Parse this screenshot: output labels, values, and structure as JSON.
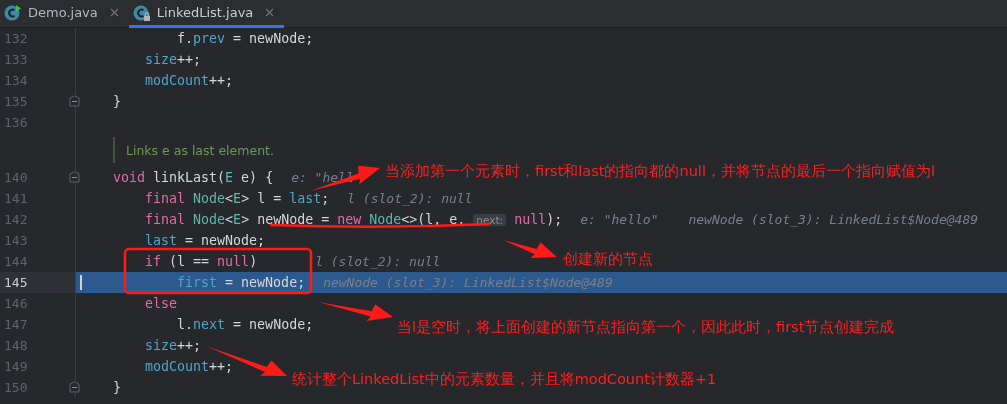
{
  "tabs": [
    {
      "label": "Demo.java",
      "selected": false,
      "runnable": true,
      "read_only": false
    },
    {
      "label": "LinkedList.java",
      "selected": true,
      "runnable": false,
      "read_only": true
    }
  ],
  "lines": [
    {
      "number": "132",
      "fold": false,
      "current": false,
      "tokens": [
        {
          "text": "        f.",
          "kind": "plain"
        },
        {
          "text": "prev",
          "kind": "field"
        },
        {
          "text": " = newNode;",
          "kind": "plain"
        }
      ]
    },
    {
      "number": "133",
      "fold": false,
      "current": false,
      "tokens": [
        {
          "text": "    size",
          "kind": "field"
        },
        {
          "text": "++;",
          "kind": "plain"
        }
      ]
    },
    {
      "number": "134",
      "fold": false,
      "current": false,
      "tokens": [
        {
          "text": "    modCount",
          "kind": "field"
        },
        {
          "text": "++;",
          "kind": "plain"
        }
      ]
    },
    {
      "number": "135",
      "fold": true,
      "current": false,
      "tokens": [
        {
          "text": "}",
          "kind": "plain"
        }
      ]
    },
    {
      "number": "136",
      "fold": false,
      "current": false
    },
    {
      "kind": "doc",
      "text": "Links e as last element."
    },
    {
      "number": "140",
      "fold": true,
      "current": false,
      "tokens": [
        {
          "text": "void",
          "kind": "keyword"
        },
        {
          "text": " linkLast(",
          "kind": "plain"
        },
        {
          "text": "E",
          "kind": "type"
        },
        {
          "text": " e) {",
          "kind": "plain"
        }
      ],
      "hints": [
        "e: \"hell"
      ]
    },
    {
      "number": "141",
      "fold": false,
      "current": false,
      "tokens": [
        {
          "text": "    final ",
          "kind": "keyword"
        },
        {
          "text": "Node",
          "kind": "type"
        },
        {
          "text": "<",
          "kind": "plain"
        },
        {
          "text": "E",
          "kind": "type"
        },
        {
          "text": "> l = ",
          "kind": "plain"
        },
        {
          "text": "last",
          "kind": "field"
        },
        {
          "text": ";",
          "kind": "plain"
        }
      ],
      "hints": [
        "l (slot_2): null"
      ]
    },
    {
      "number": "142",
      "fold": false,
      "current": false,
      "tokens": [
        {
          "text": "    final ",
          "kind": "keyword"
        },
        {
          "text": "Node",
          "kind": "type"
        },
        {
          "text": "<",
          "kind": "plain"
        },
        {
          "text": "E",
          "kind": "type"
        },
        {
          "text": "> newNode = ",
          "kind": "plain"
        },
        {
          "text": "new ",
          "kind": "keyword"
        },
        {
          "text": "Node",
          "kind": "type"
        },
        {
          "text": "<>(l, e, ",
          "kind": "plain"
        },
        {
          "text": "next:",
          "kind": "param"
        },
        {
          "text": " null",
          "kind": "keyword"
        },
        {
          "text": ");",
          "kind": "plain"
        }
      ],
      "hints": [
        "e: \"hello\"",
        "newNode (slot_3): LinkedList$Node@489"
      ]
    },
    {
      "number": "143",
      "fold": false,
      "current": false,
      "tokens": [
        {
          "text": "    last",
          "kind": "field"
        },
        {
          "text": " = newNode;",
          "kind": "plain"
        }
      ]
    },
    {
      "number": "144",
      "fold": false,
      "current": false,
      "tokens": [
        {
          "text": "    if",
          "kind": "keyword"
        },
        {
          "text": " (l == ",
          "kind": "plain"
        },
        {
          "text": "null",
          "kind": "keyword"
        },
        {
          "text": ")",
          "kind": "plain"
        }
      ],
      "hints": [
        "l (slot_2): null"
      ]
    },
    {
      "number": "145",
      "fold": false,
      "current": true,
      "tokens": [
        {
          "text": "        first",
          "kind": "field"
        },
        {
          "text": " = newNode;",
          "kind": "plain"
        }
      ],
      "hints": [
        "newNode (slot_3): LinkedList$Node@489"
      ]
    },
    {
      "number": "146",
      "fold": false,
      "current": false,
      "tokens": [
        {
          "text": "    else",
          "kind": "keyword"
        }
      ]
    },
    {
      "number": "147",
      "fold": false,
      "current": false,
      "tokens": [
        {
          "text": "        l.",
          "kind": "plain"
        },
        {
          "text": "next",
          "kind": "field"
        },
        {
          "text": " = newNode;",
          "kind": "plain"
        }
      ]
    },
    {
      "number": "148",
      "fold": false,
      "current": false,
      "tokens": [
        {
          "text": "    size",
          "kind": "field"
        },
        {
          "text": "++;",
          "kind": "plain"
        }
      ]
    },
    {
      "number": "149",
      "fold": false,
      "current": false,
      "tokens": [
        {
          "text": "    modCount",
          "kind": "field"
        },
        {
          "text": "++;",
          "kind": "plain"
        }
      ]
    },
    {
      "number": "150",
      "fold": true,
      "current": false,
      "tokens": [
        {
          "text": "}",
          "kind": "plain"
        }
      ]
    }
  ],
  "annotations": [
    "当添加第一个元素时，first和last的指向都的null，并将节点的最后一个指向赋值为l",
    "创建新的节点",
    "当l是空时，将上面创建的新节点指向第一个，因此此时，first节点创建完成",
    "统计整个LinkedList中的元素数量，并且将modCount计数器+1"
  ]
}
